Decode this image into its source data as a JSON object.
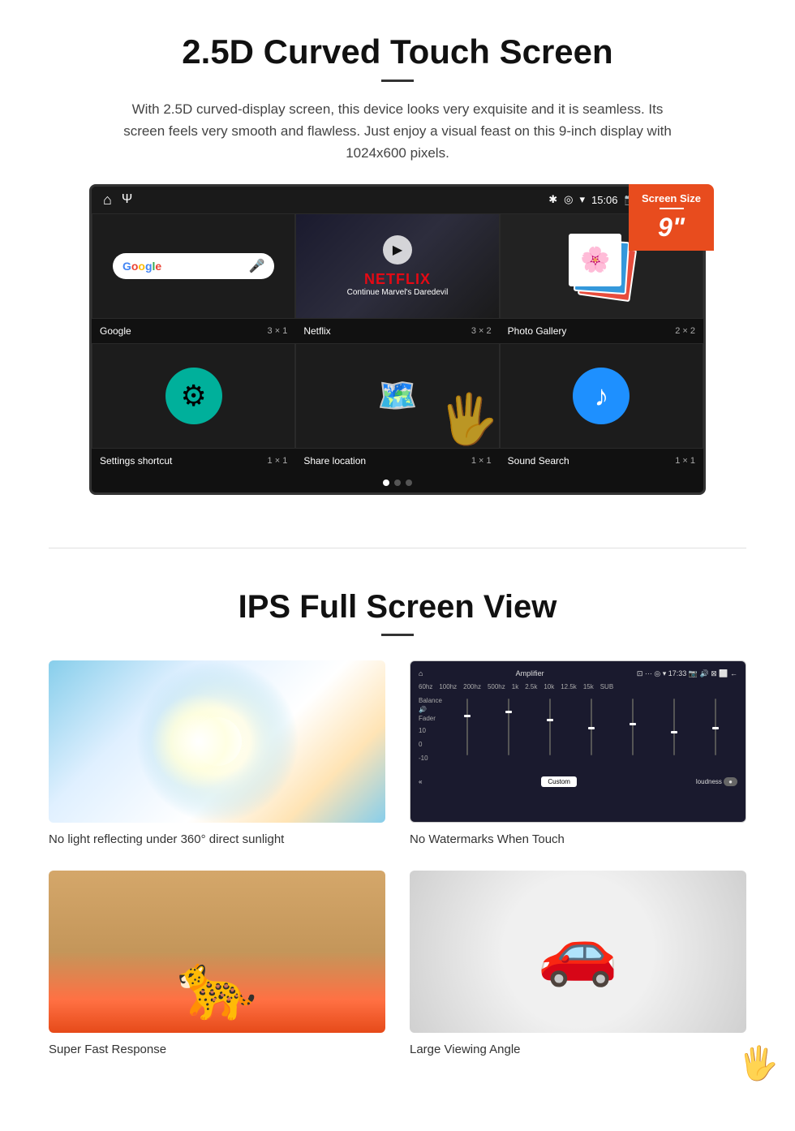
{
  "section1": {
    "title": "2.5D Curved Touch Screen",
    "description": "With 2.5D curved-display screen, this device looks very exquisite and it is seamless. Its screen feels very smooth and flawless. Just enjoy a visual feast on this 9-inch display with 1024x600 pixels.",
    "screen_size_label": "Screen Size",
    "screen_size_value": "9\"",
    "status_bar": {
      "time": "15:06"
    },
    "apps": [
      {
        "name": "Google",
        "size": "3 × 1"
      },
      {
        "name": "Netflix",
        "size": "3 × 2"
      },
      {
        "name": "Photo Gallery",
        "size": "2 × 2"
      },
      {
        "name": "Settings shortcut",
        "size": "1 × 1"
      },
      {
        "name": "Share location",
        "size": "1 × 1"
      },
      {
        "name": "Sound Search",
        "size": "1 × 1"
      }
    ],
    "netflix_text": "NETFLIX",
    "netflix_sub": "Continue Marvel's Daredevil"
  },
  "section2": {
    "title": "IPS Full Screen View",
    "features": [
      {
        "type": "sunlight",
        "caption": "No light reflecting under 360° direct sunlight"
      },
      {
        "type": "amplifier",
        "caption": "No Watermarks When Touch"
      },
      {
        "type": "cheetah",
        "caption": "Super Fast Response"
      },
      {
        "type": "car",
        "caption": "Large Viewing Angle"
      }
    ]
  },
  "icons": {
    "home": "⌂",
    "usb": "Ψ",
    "bluetooth": "✱",
    "location": "◎",
    "wifi": "▾",
    "camera": "📷",
    "volume": "🔊",
    "screen": "⊠",
    "window": "⬜",
    "mic": "🎤",
    "play": "▶",
    "settings_gear": "⚙",
    "music_note": "♪"
  }
}
